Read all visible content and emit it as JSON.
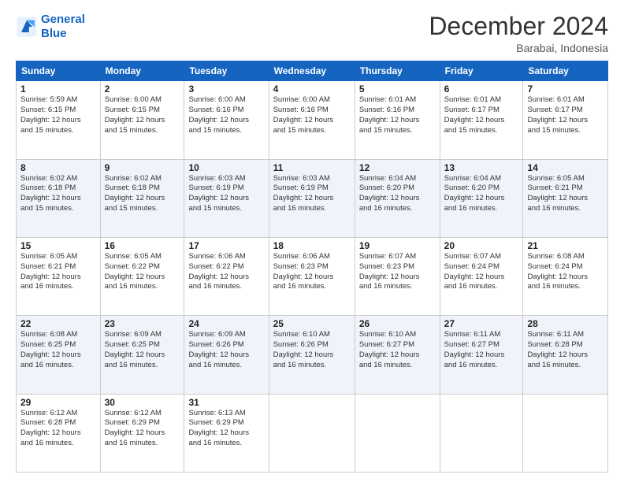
{
  "logo": {
    "line1": "General",
    "line2": "Blue"
  },
  "title": "December 2024",
  "subtitle": "Barabai, Indonesia",
  "days_header": [
    "Sunday",
    "Monday",
    "Tuesday",
    "Wednesday",
    "Thursday",
    "Friday",
    "Saturday"
  ],
  "weeks": [
    [
      {
        "day": "1",
        "info": "Sunrise: 5:59 AM\nSunset: 6:15 PM\nDaylight: 12 hours\nand 15 minutes."
      },
      {
        "day": "2",
        "info": "Sunrise: 6:00 AM\nSunset: 6:15 PM\nDaylight: 12 hours\nand 15 minutes."
      },
      {
        "day": "3",
        "info": "Sunrise: 6:00 AM\nSunset: 6:16 PM\nDaylight: 12 hours\nand 15 minutes."
      },
      {
        "day": "4",
        "info": "Sunrise: 6:00 AM\nSunset: 6:16 PM\nDaylight: 12 hours\nand 15 minutes."
      },
      {
        "day": "5",
        "info": "Sunrise: 6:01 AM\nSunset: 6:16 PM\nDaylight: 12 hours\nand 15 minutes."
      },
      {
        "day": "6",
        "info": "Sunrise: 6:01 AM\nSunset: 6:17 PM\nDaylight: 12 hours\nand 15 minutes."
      },
      {
        "day": "7",
        "info": "Sunrise: 6:01 AM\nSunset: 6:17 PM\nDaylight: 12 hours\nand 15 minutes."
      }
    ],
    [
      {
        "day": "8",
        "info": "Sunrise: 6:02 AM\nSunset: 6:18 PM\nDaylight: 12 hours\nand 15 minutes."
      },
      {
        "day": "9",
        "info": "Sunrise: 6:02 AM\nSunset: 6:18 PM\nDaylight: 12 hours\nand 15 minutes."
      },
      {
        "day": "10",
        "info": "Sunrise: 6:03 AM\nSunset: 6:19 PM\nDaylight: 12 hours\nand 15 minutes."
      },
      {
        "day": "11",
        "info": "Sunrise: 6:03 AM\nSunset: 6:19 PM\nDaylight: 12 hours\nand 16 minutes."
      },
      {
        "day": "12",
        "info": "Sunrise: 6:04 AM\nSunset: 6:20 PM\nDaylight: 12 hours\nand 16 minutes."
      },
      {
        "day": "13",
        "info": "Sunrise: 6:04 AM\nSunset: 6:20 PM\nDaylight: 12 hours\nand 16 minutes."
      },
      {
        "day": "14",
        "info": "Sunrise: 6:05 AM\nSunset: 6:21 PM\nDaylight: 12 hours\nand 16 minutes."
      }
    ],
    [
      {
        "day": "15",
        "info": "Sunrise: 6:05 AM\nSunset: 6:21 PM\nDaylight: 12 hours\nand 16 minutes."
      },
      {
        "day": "16",
        "info": "Sunrise: 6:05 AM\nSunset: 6:22 PM\nDaylight: 12 hours\nand 16 minutes."
      },
      {
        "day": "17",
        "info": "Sunrise: 6:06 AM\nSunset: 6:22 PM\nDaylight: 12 hours\nand 16 minutes."
      },
      {
        "day": "18",
        "info": "Sunrise: 6:06 AM\nSunset: 6:23 PM\nDaylight: 12 hours\nand 16 minutes."
      },
      {
        "day": "19",
        "info": "Sunrise: 6:07 AM\nSunset: 6:23 PM\nDaylight: 12 hours\nand 16 minutes."
      },
      {
        "day": "20",
        "info": "Sunrise: 6:07 AM\nSunset: 6:24 PM\nDaylight: 12 hours\nand 16 minutes."
      },
      {
        "day": "21",
        "info": "Sunrise: 6:08 AM\nSunset: 6:24 PM\nDaylight: 12 hours\nand 16 minutes."
      }
    ],
    [
      {
        "day": "22",
        "info": "Sunrise: 6:08 AM\nSunset: 6:25 PM\nDaylight: 12 hours\nand 16 minutes."
      },
      {
        "day": "23",
        "info": "Sunrise: 6:09 AM\nSunset: 6:25 PM\nDaylight: 12 hours\nand 16 minutes."
      },
      {
        "day": "24",
        "info": "Sunrise: 6:09 AM\nSunset: 6:26 PM\nDaylight: 12 hours\nand 16 minutes."
      },
      {
        "day": "25",
        "info": "Sunrise: 6:10 AM\nSunset: 6:26 PM\nDaylight: 12 hours\nand 16 minutes."
      },
      {
        "day": "26",
        "info": "Sunrise: 6:10 AM\nSunset: 6:27 PM\nDaylight: 12 hours\nand 16 minutes."
      },
      {
        "day": "27",
        "info": "Sunrise: 6:11 AM\nSunset: 6:27 PM\nDaylight: 12 hours\nand 16 minutes."
      },
      {
        "day": "28",
        "info": "Sunrise: 6:11 AM\nSunset: 6:28 PM\nDaylight: 12 hours\nand 16 minutes."
      }
    ],
    [
      {
        "day": "29",
        "info": "Sunrise: 6:12 AM\nSunset: 6:28 PM\nDaylight: 12 hours\nand 16 minutes."
      },
      {
        "day": "30",
        "info": "Sunrise: 6:12 AM\nSunset: 6:29 PM\nDaylight: 12 hours\nand 16 minutes."
      },
      {
        "day": "31",
        "info": "Sunrise: 6:13 AM\nSunset: 6:29 PM\nDaylight: 12 hours\nand 16 minutes."
      },
      null,
      null,
      null,
      null
    ]
  ]
}
